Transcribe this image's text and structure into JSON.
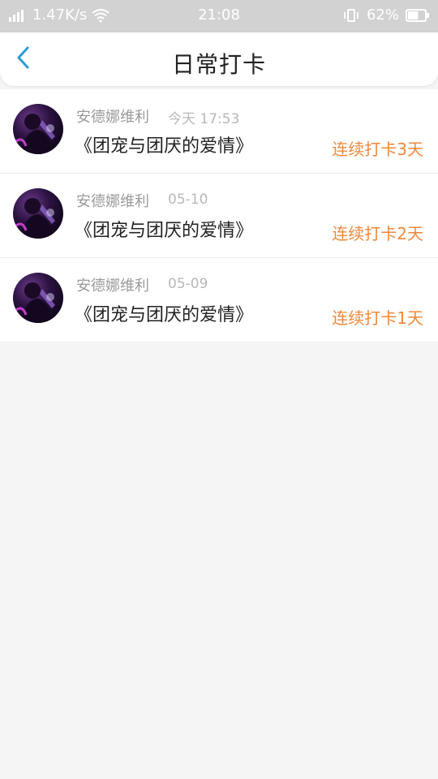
{
  "status_bar": {
    "speed": "1.47K/s",
    "time": "21:08",
    "battery": "62%",
    "battery_level": 0.62
  },
  "header": {
    "title": "日常打卡"
  },
  "checkins": [
    {
      "username": "安德娜维利",
      "time": "今天 17:53",
      "book": "《团宠与团厌的爱情》",
      "streak": "连续打卡3天"
    },
    {
      "username": "安德娜维利",
      "time": "05-10",
      "book": "《团宠与团厌的爱情》",
      "streak": "连续打卡2天"
    },
    {
      "username": "安德娜维利",
      "time": "05-09",
      "book": "《团宠与团厌的爱情》",
      "streak": "连续打卡1天"
    }
  ],
  "colors": {
    "accent_streak": "#f0883a",
    "back_icon": "#2b9bd8",
    "status_bar_bg": "#d2d2d2"
  }
}
